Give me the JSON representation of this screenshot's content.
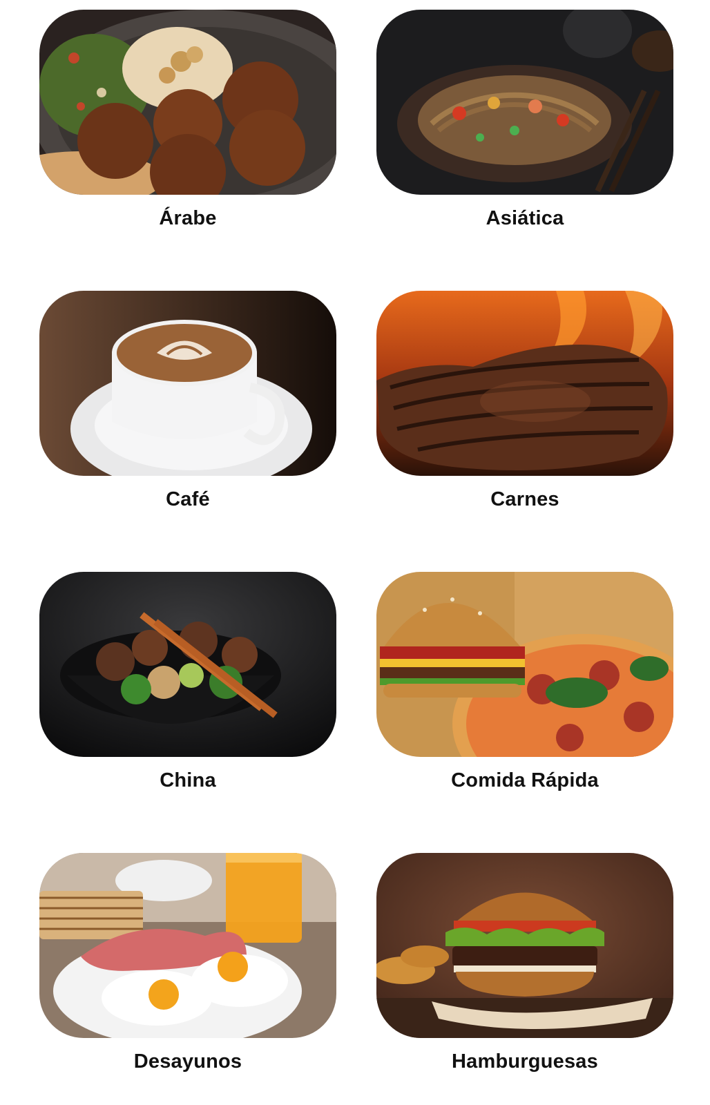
{
  "categories": [
    {
      "label": "Árabe",
      "image": "falafel-hummus-plate"
    },
    {
      "label": "Asiática",
      "image": "stir-fry-noodles-bowl"
    },
    {
      "label": "Café",
      "image": "latte-art-cup"
    },
    {
      "label": "Carnes",
      "image": "grilled-steak"
    },
    {
      "label": "China",
      "image": "beef-broccoli-bowl-chopsticks"
    },
    {
      "label": "Comida Rápida",
      "image": "burger-and-pizza"
    },
    {
      "label": "Desayunos",
      "image": "eggs-bacon-toast-juice"
    },
    {
      "label": "Hamburguesas",
      "image": "gourmet-burger"
    }
  ]
}
